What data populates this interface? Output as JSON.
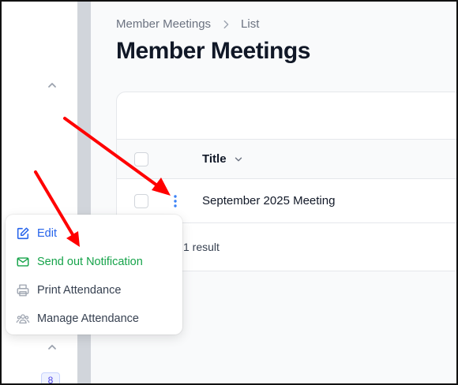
{
  "breadcrumb": {
    "parent": "Member Meetings",
    "current": "List"
  },
  "page": {
    "title": "Member Meetings"
  },
  "table": {
    "columns": [
      {
        "label": "Title"
      }
    ],
    "rows": [
      {
        "title": "September 2025 Meeting"
      }
    ],
    "result_count": "1 result"
  },
  "sidebar": {
    "badge_count": "8"
  },
  "action_menu": {
    "items": [
      {
        "label": "Edit",
        "icon": "pencil-square-icon",
        "color": "#2563eb"
      },
      {
        "label": "Send out Notification",
        "icon": "envelope-icon",
        "color": "#16a34a"
      },
      {
        "label": "Print Attendance",
        "icon": "printer-icon",
        "color": "#374151"
      },
      {
        "label": "Manage Attendance",
        "icon": "user-group-icon",
        "color": "#374151"
      }
    ]
  },
  "annotations": {
    "arrow_color": "#ff0000"
  },
  "colors": {
    "divider": "#d1d5db",
    "accent": "#3b82f6"
  }
}
